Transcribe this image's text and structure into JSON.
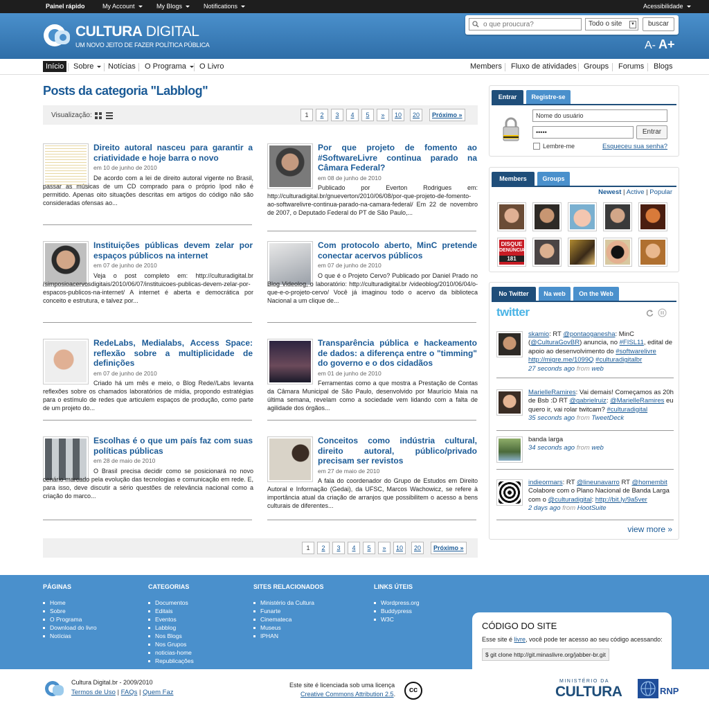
{
  "adminbar": {
    "quick": "Painel rápido",
    "account": "My Account",
    "blogs": "My Blogs",
    "notifications": "Notifications",
    "accessibility": "Acessibilidade"
  },
  "header": {
    "title_bold": "CULTURA",
    "title_light": " DIGITAL",
    "tagline": "UM NOVO JEITO DE FAZER POLÍTICA PÚBLICA",
    "search": {
      "placeholder": "o que proucura?",
      "scope": "Todo o site",
      "button": "buscar"
    },
    "font_small": "A-",
    "font_big": "A+"
  },
  "nav": {
    "left": [
      "Início",
      "Sobre",
      "Notícias",
      "O Programa",
      "O Livro"
    ],
    "right": [
      "Members",
      "Fluxo de atividades",
      "Groups",
      "Forums",
      "Blogs"
    ]
  },
  "main": {
    "title": "Posts da categoria \"Labblog\"",
    "view_label": "Visualização:",
    "pages": [
      "1",
      "2",
      "3",
      "4",
      "5",
      "»",
      "10",
      "20",
      "Próximo »"
    ],
    "posts": [
      {
        "title": "Direito autoral nasceu para garantir a criatividade e hoje barra o novo",
        "date": "em 10 de junho de 2010",
        "excerpt": "De acordo com a lei de direito autoral vigente no Brasil, passar as músicas de um CD comprado para o próprio Ipod não é permitido. Apenas oito situações descritas em artigos do código não são consideradas ofensas ao..."
      },
      {
        "title": "Por que projeto de fomento ao #SoftwareLivre continua parado na Câmara Federal?",
        "date": "em 08 de junho de 2010",
        "excerpt": "Publicado por Everton Rodrigues em: http://culturadigital.br/gnueverton/2010/06/08/por-que-projeto-de-fomento-ao-softwarelivre-continua-parado-na-camara-federal/ Em 22 de novembro de 2007, o Deputado Federal do PT de São Paulo,..."
      },
      {
        "title": "Instituições públicas devem zelar por espaços públicos na internet",
        "date": "em 07 de junho de 2010",
        "excerpt": "Veja o post completo em: http://culturadigital.br /simposioacervosdigitais/2010/06/07/instituicoes-publicas-devem-zelar-por-espacos-publicos-na-internet/ A internet é aberta e democrática por conceito e estrutura, e talvez por..."
      },
      {
        "title": "Com protocolo aberto, MinC pretende conectar acervos públicos",
        "date": "em 07 de junho de 2010",
        "excerpt": "O que é o Projeto Cervo? Publicado por Daniel Prado no Blog Videolog, o laboratório: http://culturadigital.br /videoblog/2010/06/04/o-que-e-o-projeto-cervo/ Você já imaginou todo o acervo da biblioteca Nacional a um clique de..."
      },
      {
        "title": "RedeLabs, Medialabs, Access Space: reflexão sobre a multiplicidade de definições",
        "date": "em 07 de junho de 2010",
        "excerpt": "Criado há um mês e meio, o Blog Rede//Labs levanta reflexões sobre os chamados laboratórios de mídia, propondo estratégias para o estímulo de redes que articulem espaços de produção, como parte de um projeto do..."
      },
      {
        "title": "Transparência pública e hackeamento de dados: a diferença entre o \"timming\" do governo e o dos cidadãos",
        "date": "em 01 de junho de 2010",
        "excerpt": "Ferramentas como a que mostra a Prestação de Contas da Câmara Municipal de São Paulo, desenvolvido por Maurício Maia na última semana, revelam como a sociedade vem lidando com a falta de agilidade dos órgãos..."
      },
      {
        "title": "Escolhas é o que um país faz com suas políticas públicas",
        "date": "em 28 de maio de 2010",
        "excerpt": "O Brasil precisa decidir como se posicionará no novo cenário marcado pela evolução das tecnologias e comunicação em rede. E, para isso, deve discutir a sério questões de relevância nacional como a criação do marco..."
      },
      {
        "title": "Conceitos como indústria cultural, direito autoral, público/privado precisam ser revistos",
        "date": "em 27 de maio de 2010",
        "excerpt": "A fala do coordenador do Grupo de Estudos em Direito Autoral e Informação (Gedai), da UFSC, Marcos Wachowicz, se refere à importância atual da criação de arranjos que possibilitem o acesso a bens culturais de diferentes..."
      }
    ]
  },
  "login": {
    "tab_login": "Entrar",
    "tab_register": "Registre-se",
    "username": "Nome do usuário",
    "password": "•••••",
    "button": "Entrar",
    "remember": "Lembre-me",
    "forgot": "Esqueceu sua senha?"
  },
  "members": {
    "tab_members": "Members",
    "tab_groups": "Groups",
    "filter_newest": "Newest",
    "filter_active": "Active",
    "filter_popular": "Popular",
    "sep": "|",
    "banner_top": "DISQUE",
    "banner_mid": "DENÚNCIA",
    "banner_num": "181"
  },
  "twitter": {
    "tabs": [
      "No Twitter",
      "Na web",
      "On the Web"
    ],
    "logo": "twitter",
    "tweets": [
      {
        "user": "skamio",
        "parts": ": RT ",
        "m1": "@pontaoganesha",
        "t1": ": MinC (",
        "m2": "@CulturaGovBR",
        "t2": ") anuncia, no ",
        "h1": "#FISL11",
        "t3": ", edital de apoio ao desenvolvimento do ",
        "h2": "#softwarelivre",
        "t4": " ",
        "l1": "http://migre.me/1099Q",
        "t5": " ",
        "h3": "#culturadigitalbr",
        "time": "27 seconds ago",
        "from": "from",
        "via": "web"
      },
      {
        "user": "MarielleRamires",
        "parts": ": Vai demais! Começamos as 20h de Bsb :D RT ",
        "m1": "@gabrielruiz",
        "t1": ": ",
        "m2": "@MarielleRamires",
        "t2": " eu quero ir, vai rolar twitcam? ",
        "h1": "#culturadigital",
        "time": "35 seconds ago",
        "from": "from",
        "via": "TweetDeck"
      },
      {
        "text": "banda larga",
        "time": "34 seconds ago",
        "from": "from",
        "via": "web"
      },
      {
        "user": "indieormars",
        "parts": ": RT ",
        "m1": "@lineunavarro",
        "t1": " RT ",
        "m2": "@homembit",
        "t2": " Colabore com o Plano Nacional de Banda Larga com o ",
        "m3": "@culturadigital",
        "t3": ": ",
        "l1": "http://bit.ly/9a5ver",
        "time": "2 days ago",
        "from": "from",
        "via": "HootSuite"
      }
    ],
    "view_more": "view more »"
  },
  "footer": {
    "cols": [
      {
        "title": "PÁGINAS",
        "items": [
          "Home",
          "Sobre",
          "O Programa",
          "Download do livro",
          "Notícias"
        ]
      },
      {
        "title": "CATEGORIAS",
        "items": [
          "Documentos",
          "Editais",
          "Eventos",
          "Labblog",
          "Nos Blogs",
          "Nos Grupos",
          "noticias-home",
          "Republicações"
        ]
      },
      {
        "title": "SITES RELACIONADOS",
        "items": [
          "Ministério da Cultura",
          "Funarte",
          "Cinemateca",
          "Museus",
          "IPHAN"
        ]
      },
      {
        "title": "LINKS ÚTEIS",
        "items": [
          "Wordpress.org",
          "Buddypress",
          "W3C"
        ]
      }
    ],
    "code_title": "CÓDIGO DO SITE",
    "code_text_1": "Esse site é ",
    "code_link": "livre",
    "code_text_2": ", você pode ter acesso ao seu código acessando:",
    "code_cmd": "$ git clone http://git.minaslivre.org/jabber-br.git"
  },
  "bottom": {
    "site": "Cultura Digital.br -  2009/2010",
    "terms": "Termos de Uso",
    "faq": "FAQs",
    "who": "Quem Faz",
    "sep": "|",
    "license_1": "Este site é licenciada sob uma licença",
    "license_link": "Creative Commons Attribution 2.5",
    "license_dot": ".",
    "cc": "cc",
    "minc_top": "MINISTÉRIO DA",
    "minc": "CULTURA",
    "rnp": "RNP"
  }
}
